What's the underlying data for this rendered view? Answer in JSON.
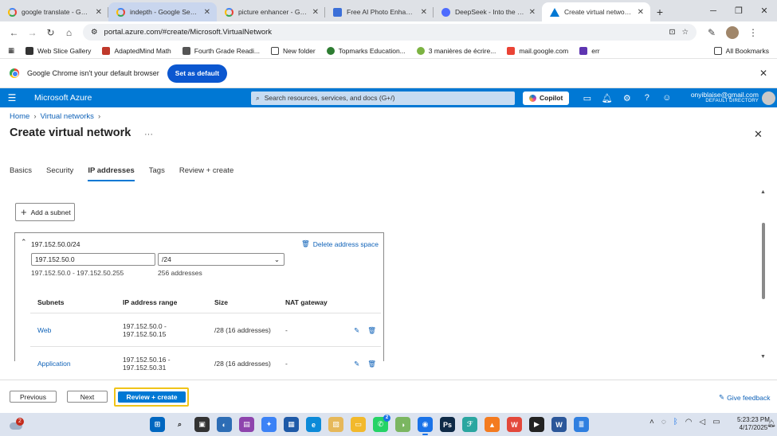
{
  "browser": {
    "tabs": [
      {
        "title": "google translate - Google Search",
        "favicon": "google-icon",
        "state": "normal"
      },
      {
        "title": "indepth - Google Search",
        "favicon": "google-icon",
        "state": "highlight"
      },
      {
        "title": "picture enhancer - Google Search",
        "favicon": "google-icon",
        "state": "normal"
      },
      {
        "title": "Free AI Photo Enhancer: Enhance",
        "favicon": "photo-enhancer-icon",
        "state": "normal"
      },
      {
        "title": "DeepSeek - Into the Unknown",
        "favicon": "deepseek-icon",
        "state": "normal"
      },
      {
        "title": "Create virtual network - Microsoft Azure",
        "favicon": "azure-icon",
        "state": "active"
      }
    ],
    "url": "portal.azure.com/#create/Microsoft.VirtualNetwork",
    "bookmarks": [
      "Web Slice Gallery",
      "AdaptedMind Math",
      "Fourth Grade Readi...",
      "New folder",
      "Topmarks Education...",
      "3 manières de écrire...",
      "mail.google.com",
      "err"
    ],
    "all_bookmarks": "All Bookmarks",
    "infobar": {
      "message": "Google Chrome isn't your default browser",
      "button": "Set as default"
    }
  },
  "azure": {
    "brand": "Microsoft Azure",
    "search_placeholder": "Search resources, services, and docs (G+/)",
    "copilot": "Copilot",
    "account_email": "onyiblaise@gmail.com",
    "account_directory": "DEFAULT DIRECTORY"
  },
  "page": {
    "breadcrumbs": [
      "Home",
      "Virtual networks"
    ],
    "title": "Create virtual network",
    "tabs": [
      "Basics",
      "Security",
      "IP addresses",
      "Tags",
      "Review + create"
    ],
    "active_tab": "IP addresses",
    "add_subnet": "Add a subnet",
    "address_space": {
      "cidr": "197.152.50.0/24",
      "delete_label": "Delete address space",
      "start_ip": "197.152.50.0",
      "prefix": "/24",
      "range": "197.152.50.0 - 197.152.50.255",
      "count": "256 addresses"
    },
    "subnet_columns": [
      "Subnets",
      "IP address range",
      "Size",
      "NAT gateway"
    ],
    "subnets": [
      {
        "name": "Web",
        "range": "197.152.50.0 - 197.152.50.15",
        "size": "/28 (16 addresses)",
        "nat": "-"
      },
      {
        "name": "Application",
        "range": "197.152.50.16 - 197.152.50.31",
        "size": "/28 (16 addresses)",
        "nat": "-"
      }
    ],
    "footer": {
      "previous": "Previous",
      "next": "Next",
      "review": "Review + create",
      "feedback": "Give feedback"
    }
  },
  "taskbar": {
    "weather_badge": "2",
    "whatsapp_badge": "2",
    "time": "5:23:23 PM",
    "date": "4/17/2025"
  },
  "colors": {
    "azure_blue": "#0078d4",
    "highlight": "#f0c419",
    "link": "#0f62b8"
  }
}
